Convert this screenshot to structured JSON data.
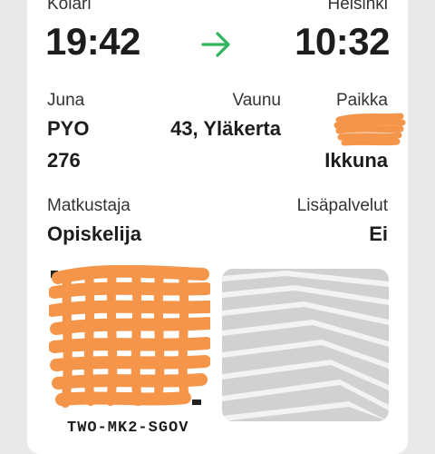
{
  "route": {
    "from_station": "Kolari",
    "to_station": "Helsinki",
    "departure_time": "19:42",
    "arrival_time": "10:32",
    "arrow_icon": "arrow-right-icon",
    "arrow_color": "#2fb55a"
  },
  "details": {
    "train_label": "Juna",
    "train_type": "PYO",
    "train_number": "276",
    "car_label": "Vaunu",
    "car_value": "43, Yläkerta",
    "seat_label": "Paikka",
    "seat_type": "Ikkuna"
  },
  "passenger": {
    "traveler_label": "Matkustaja",
    "traveler_value": "Opiskelija",
    "extras_label": "Lisäpalvelut",
    "extras_value": "Ei"
  },
  "ticket": {
    "code": "TWO-MK2-SGOV"
  },
  "colors": {
    "redaction": "#f5954a",
    "panel_gray": "#d1d1d1"
  }
}
